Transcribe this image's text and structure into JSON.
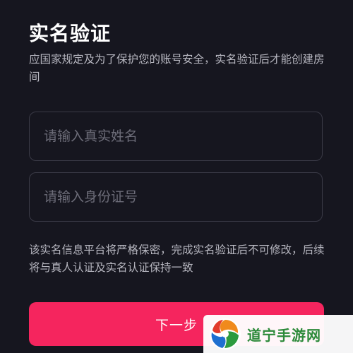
{
  "page": {
    "title": "实名验证",
    "description": "应国家规定及为了保护您的账号安全，实名验证后才能创建房间",
    "notice": "该实名信息平台将严格保密，完成实名验证后不可修改，后续将与真人认证及实名认证保持一致"
  },
  "form": {
    "name_placeholder": "请输入真实姓名",
    "id_placeholder": "请输入身份证号",
    "next_label": "下一步"
  },
  "watermark": {
    "text": "道宁手游网",
    "icon": "swirl-logo-icon"
  },
  "colors": {
    "background": "#16161f",
    "accent": "#f5255e",
    "field_border": "#3a3a46",
    "muted_text": "#b7b7c0",
    "placeholder": "#6c6c78"
  }
}
